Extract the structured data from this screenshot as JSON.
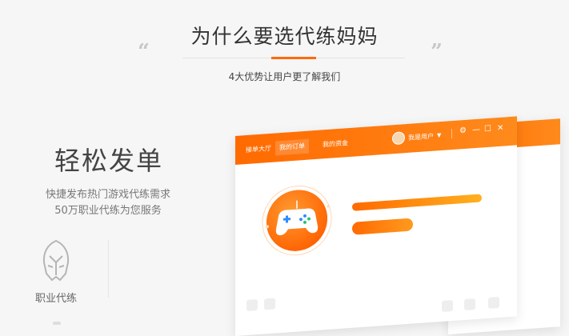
{
  "header": {
    "title": "为什么要选代练妈妈",
    "quote_left": "“",
    "quote_right": "”",
    "subtitle": "4大优势让用户更了解我们"
  },
  "feature": {
    "heading": "轻松发单",
    "desc_line1": "快捷发布热门游戏代练需求",
    "desc_line2": "50万职业代练为您服务",
    "badge_label": "职业代练",
    "badge_icon": "helmet-icon"
  },
  "app_window": {
    "tabs": [
      {
        "label": "接单大厅"
      },
      {
        "label": "我的订单"
      },
      {
        "label": "我的资金"
      }
    ],
    "active_tab": "我的订单",
    "user_label": "我是用户",
    "controls": [
      "gear-icon",
      "minimize-icon",
      "maximize-icon",
      "close-icon"
    ],
    "accent_color": "#ff6a00",
    "accent_color_end": "#ffb020"
  }
}
